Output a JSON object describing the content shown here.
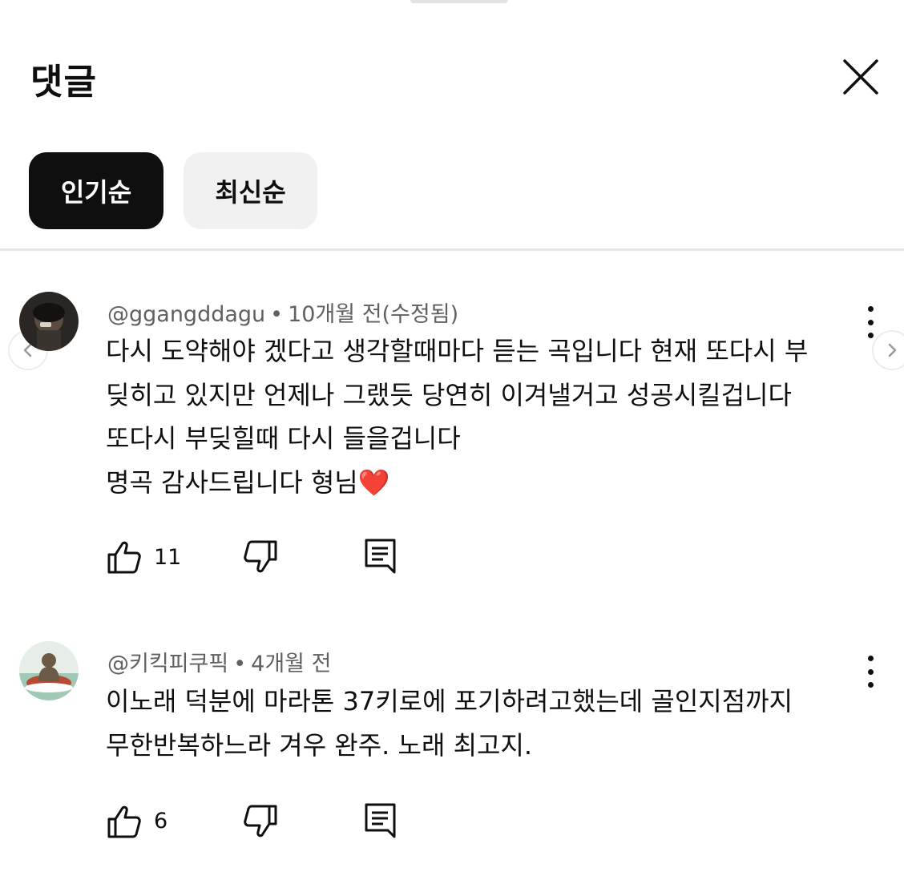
{
  "panel": {
    "title": "댓글"
  },
  "sort_chips": [
    {
      "label": "인기순",
      "selected": true
    },
    {
      "label": "최신순",
      "selected": false
    }
  ],
  "comments": [
    {
      "author": "@ggangddagu",
      "separator": "•",
      "time": "10개월 전(수정됨)",
      "text": "다시 도약해야 겠다고 생각할때마다 듣는 곡입니다 현재 또다시 부\n딪히고 있지만 언제나 그랬듯 당연히 이겨낼거고 성공시킬겁니다\n또다시 부딪힐때 다시 들을겁니다\n명곡 감사드립니다 형님",
      "emoji": "❤️",
      "likes": "11",
      "avatar_icon": "person-photo-avatar"
    },
    {
      "author": "@키킥피쿠픽",
      "separator": "•",
      "time": "4개월 전",
      "text": "이노래 덕분에   마라톤 37키로에 포기하려고했는데  골인지점까지\n무한반복하느라 겨우 완주.  노래 최고지.",
      "emoji": "",
      "likes": "6",
      "avatar_icon": "buddha-statue-avatar"
    }
  ],
  "icons": {
    "close": "close-icon",
    "like": "thumbs-up-icon",
    "dislike": "thumbs-down-icon",
    "reply": "reply-icon",
    "more": "more-vert-icon",
    "carousel_prev": "chevron-left-icon",
    "carousel_next": "chevron-right-icon"
  },
  "colors": {
    "chip_selected_bg": "#0f0f0f",
    "chip_unselected_bg": "#f1f1f1",
    "meta_text": "#606060",
    "heart": "#e8262c"
  }
}
